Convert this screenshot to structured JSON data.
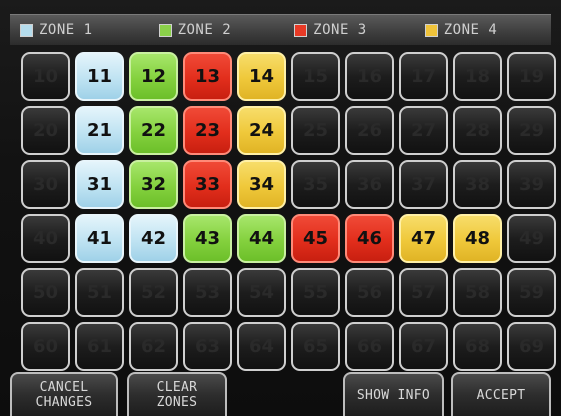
{
  "legend": [
    {
      "label": "ZONE 1",
      "color": "#b5dcec"
    },
    {
      "label": "ZONE 2",
      "color": "#8bd14a"
    },
    {
      "label": "ZONE 3",
      "color": "#e83a26"
    },
    {
      "label": "ZONE 4",
      "color": "#efc33a"
    }
  ],
  "zone_colors": {
    "z1": "#bfe3f2",
    "z2": "#84d13e",
    "z3": "#e22e1c",
    "z4": "#efc83a",
    "off": "#1d1d1d"
  },
  "grid": {
    "rows": [
      [
        {
          "n": "10",
          "z": "off"
        },
        {
          "n": "11",
          "z": "z1"
        },
        {
          "n": "12",
          "z": "z2"
        },
        {
          "n": "13",
          "z": "z3"
        },
        {
          "n": "14",
          "z": "z4"
        },
        {
          "n": "15",
          "z": "off"
        },
        {
          "n": "16",
          "z": "off"
        },
        {
          "n": "17",
          "z": "off"
        },
        {
          "n": "18",
          "z": "off"
        },
        {
          "n": "19",
          "z": "off"
        }
      ],
      [
        {
          "n": "20",
          "z": "off"
        },
        {
          "n": "21",
          "z": "z1"
        },
        {
          "n": "22",
          "z": "z2"
        },
        {
          "n": "23",
          "z": "z3"
        },
        {
          "n": "24",
          "z": "z4"
        },
        {
          "n": "25",
          "z": "off"
        },
        {
          "n": "26",
          "z": "off"
        },
        {
          "n": "27",
          "z": "off"
        },
        {
          "n": "28",
          "z": "off"
        },
        {
          "n": "29",
          "z": "off"
        }
      ],
      [
        {
          "n": "30",
          "z": "off"
        },
        {
          "n": "31",
          "z": "z1"
        },
        {
          "n": "32",
          "z": "z2"
        },
        {
          "n": "33",
          "z": "z3"
        },
        {
          "n": "34",
          "z": "z4"
        },
        {
          "n": "35",
          "z": "off"
        },
        {
          "n": "36",
          "z": "off"
        },
        {
          "n": "37",
          "z": "off"
        },
        {
          "n": "38",
          "z": "off"
        },
        {
          "n": "39",
          "z": "off"
        }
      ],
      [
        {
          "n": "40",
          "z": "off"
        },
        {
          "n": "41",
          "z": "z1"
        },
        {
          "n": "42",
          "z": "z1"
        },
        {
          "n": "43",
          "z": "z2"
        },
        {
          "n": "44",
          "z": "z2"
        },
        {
          "n": "45",
          "z": "z3"
        },
        {
          "n": "46",
          "z": "z3"
        },
        {
          "n": "47",
          "z": "z4"
        },
        {
          "n": "48",
          "z": "z4"
        },
        {
          "n": "49",
          "z": "off"
        }
      ],
      [
        {
          "n": "50",
          "z": "off"
        },
        {
          "n": "51",
          "z": "off"
        },
        {
          "n": "52",
          "z": "off"
        },
        {
          "n": "53",
          "z": "off"
        },
        {
          "n": "54",
          "z": "off"
        },
        {
          "n": "55",
          "z": "off"
        },
        {
          "n": "56",
          "z": "off"
        },
        {
          "n": "57",
          "z": "off"
        },
        {
          "n": "58",
          "z": "off"
        },
        {
          "n": "59",
          "z": "off"
        }
      ],
      [
        {
          "n": "60",
          "z": "off"
        },
        {
          "n": "61",
          "z": "off"
        },
        {
          "n": "62",
          "z": "off"
        },
        {
          "n": "63",
          "z": "off"
        },
        {
          "n": "64",
          "z": "off"
        },
        {
          "n": "65",
          "z": "off"
        },
        {
          "n": "66",
          "z": "off"
        },
        {
          "n": "67",
          "z": "off"
        },
        {
          "n": "68",
          "z": "off"
        },
        {
          "n": "69",
          "z": "off"
        }
      ]
    ]
  },
  "buttons": {
    "cancel": [
      "CANCEL",
      "CHANGES"
    ],
    "clear": [
      "CLEAR",
      "ZONES"
    ],
    "show_info": "SHOW INFO",
    "accept": "ACCEPT"
  }
}
